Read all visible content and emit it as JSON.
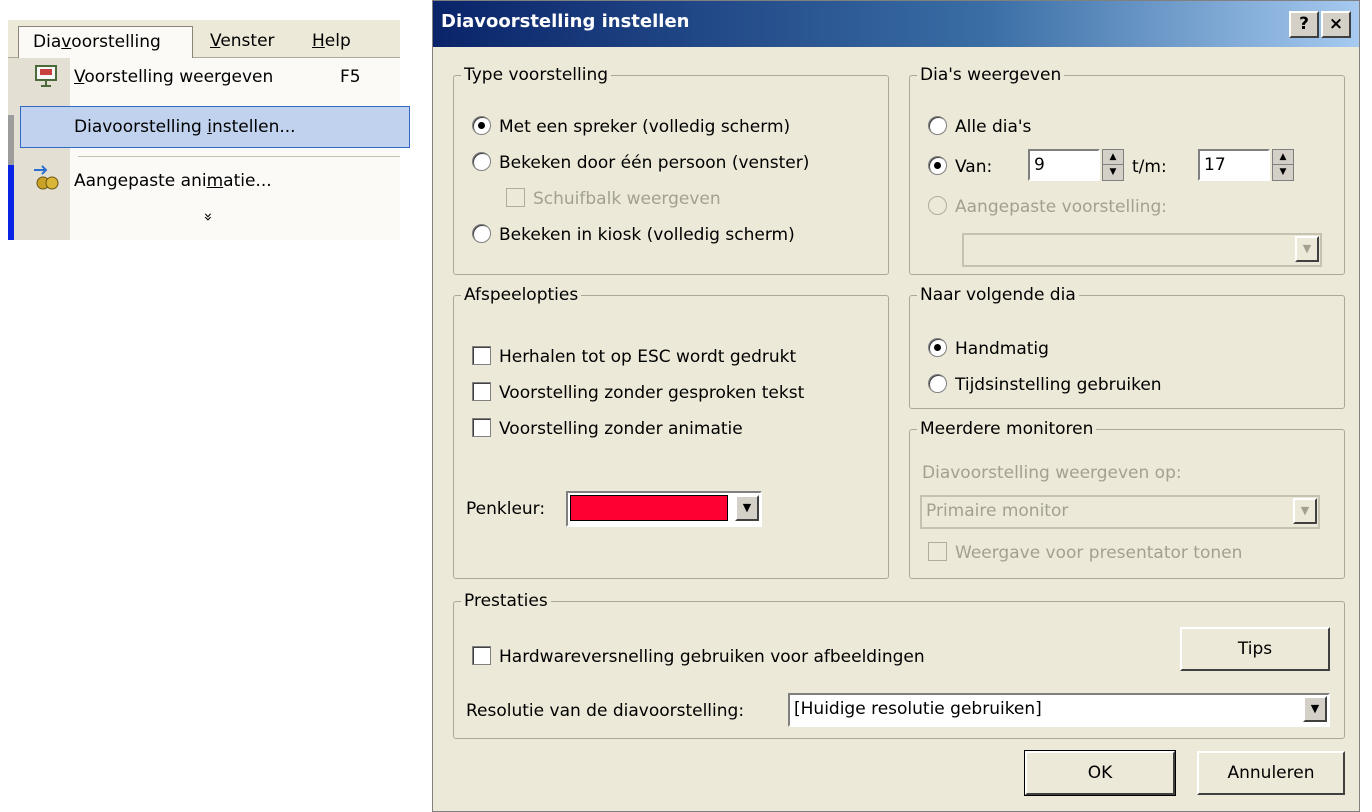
{
  "menu": {
    "bar": [
      "Diavoorstelling",
      "Venster",
      "Help"
    ],
    "items": [
      {
        "label": "Voorstelling weergeven",
        "shortcut": "F5"
      },
      {
        "label": "Diavoorstelling instellen..."
      },
      {
        "label": "Aangepaste animatie..."
      }
    ],
    "more": "»"
  },
  "dialog": {
    "title": "Diavoorstelling instellen",
    "help_btn": "?",
    "close_btn": "×",
    "type": {
      "legend": "Type voorstelling",
      "opt1": "Met een spreker (volledig scherm)",
      "opt2": "Bekeken door één persoon (venster)",
      "scrollbar": "Schuifbalk weergeven",
      "opt3": "Bekeken in kiosk (volledig scherm)"
    },
    "slides": {
      "legend": "Dia's weergeven",
      "all": "Alle dia's",
      "from_label": "Van:",
      "from_value": "9",
      "to_label": "t/m:",
      "to_value": "17",
      "custom": "Aangepaste voorstelling:"
    },
    "play": {
      "legend": "Afspeelopties",
      "opt1": "Herhalen tot op ESC wordt gedrukt",
      "opt2": "Voorstelling zonder gesproken tekst",
      "opt3": "Voorstelling zonder animatie",
      "pen_label": "Penkleur:",
      "pen_color": "#ff0033"
    },
    "advance": {
      "legend": "Naar volgende dia",
      "manual": "Handmatig",
      "timing": "Tijdsinstelling gebruiken"
    },
    "monitors": {
      "legend": "Meerdere monitoren",
      "label": "Diavoorstelling weergeven op:",
      "value": "Primaire monitor",
      "presenter": "Weergave voor presentator tonen"
    },
    "perf": {
      "legend": "Prestaties",
      "hw": "Hardwareversnelling gebruiken voor afbeeldingen",
      "tips": "Tips",
      "res_label": "Resolutie van de diavoorstelling:",
      "res_value": "[Huidige resolutie gebruiken]"
    },
    "ok": "OK",
    "cancel": "Annuleren"
  }
}
